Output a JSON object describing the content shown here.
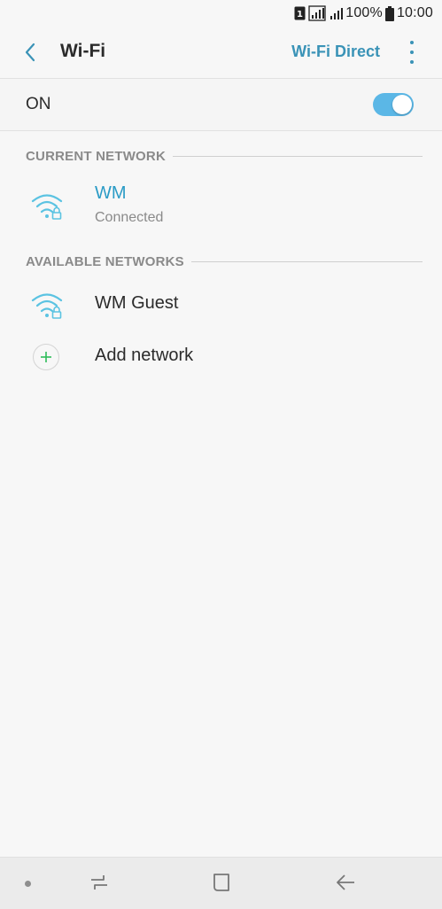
{
  "status_bar": {
    "battery_text": "100%",
    "time": "10:00",
    "sim_label": "1"
  },
  "header": {
    "title": "Wi-Fi",
    "wifi_direct_label": "Wi-Fi Direct"
  },
  "wifi_toggle": {
    "label": "ON",
    "enabled": true
  },
  "current_network": {
    "section_label": "CURRENT NETWORK",
    "name": "WM",
    "status": "Connected"
  },
  "available_networks": {
    "section_label": "AVAILABLE NETWORKS",
    "items": [
      {
        "name": "WM Guest"
      }
    ],
    "add_label": "Add network"
  },
  "colors": {
    "accent": "#3a93b7",
    "active_network": "#2a9bc6",
    "toggle_on": "#5bb7e6",
    "add_plus": "#2ebd59"
  }
}
